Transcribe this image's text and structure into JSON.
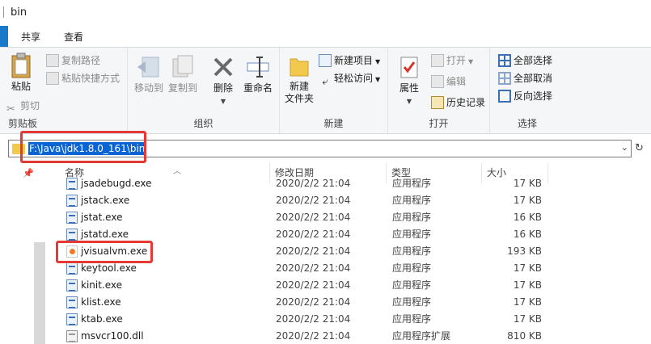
{
  "window": {
    "title": "bin"
  },
  "ribbon_tabs": [
    "共享",
    "查看"
  ],
  "ribbon": {
    "clipboard": {
      "group_label": "剪贴板",
      "paste": "粘贴",
      "copy_path": "复制路径",
      "paste_shortcut": "粘贴快捷方式",
      "cut": "剪切"
    },
    "organize": {
      "group_label": "组织",
      "move_to": "移动到",
      "copy_to": "复制到",
      "delete": "删除",
      "rename": "重命名"
    },
    "new": {
      "group_label": "新建",
      "new_folder_line1": "新建",
      "new_folder_line2": "文件夹",
      "new_item": "新建项目",
      "easy_access": "轻松访问"
    },
    "open": {
      "group_label": "打开",
      "properties": "属性",
      "open": "打开",
      "edit": "编辑",
      "history": "历史记录"
    },
    "select": {
      "group_label": "选择",
      "select_all": "全部选择",
      "select_none": "全部取消",
      "invert": "反向选择"
    }
  },
  "address": {
    "path": "F:\\Java\\jdk1.8.0_161\\bin"
  },
  "columns": {
    "name": "名称",
    "date": "修改日期",
    "type": "类型",
    "size": "大小"
  },
  "files": [
    {
      "name": "jsadebugd.exe",
      "date": "2020/2/2 21:04",
      "type": "应用程序",
      "size": "17 KB",
      "icon": "exe-icon"
    },
    {
      "name": "jstack.exe",
      "date": "2020/2/2 21:04",
      "type": "应用程序",
      "size": "17 KB",
      "icon": "exe-icon"
    },
    {
      "name": "jstat.exe",
      "date": "2020/2/2 21:04",
      "type": "应用程序",
      "size": "16 KB",
      "icon": "exe-icon"
    },
    {
      "name": "jstatd.exe",
      "date": "2020/2/2 21:04",
      "type": "应用程序",
      "size": "16 KB",
      "icon": "exe-icon"
    },
    {
      "name": "jvisualvm.exe",
      "date": "2020/2/2 21:04",
      "type": "应用程序",
      "size": "193 KB",
      "icon": "jvisualvm-icon"
    },
    {
      "name": "keytool.exe",
      "date": "2020/2/2 21:04",
      "type": "应用程序",
      "size": "17 KB",
      "icon": "exe-icon"
    },
    {
      "name": "kinit.exe",
      "date": "2020/2/2 21:04",
      "type": "应用程序",
      "size": "17 KB",
      "icon": "exe-icon"
    },
    {
      "name": "klist.exe",
      "date": "2020/2/2 21:04",
      "type": "应用程序",
      "size": "17 KB",
      "icon": "exe-icon"
    },
    {
      "name": "ktab.exe",
      "date": "2020/2/2 21:04",
      "type": "应用程序",
      "size": "17 KB",
      "icon": "exe-icon"
    },
    {
      "name": "msvcr100.dll",
      "date": "2020/2/2 21:04",
      "type": "应用程序扩展",
      "size": "810 KB",
      "icon": "dll-icon"
    }
  ],
  "colors": {
    "accent": "#1979ca",
    "selection": "#0a64d4",
    "highlight_box": "#e53935"
  }
}
